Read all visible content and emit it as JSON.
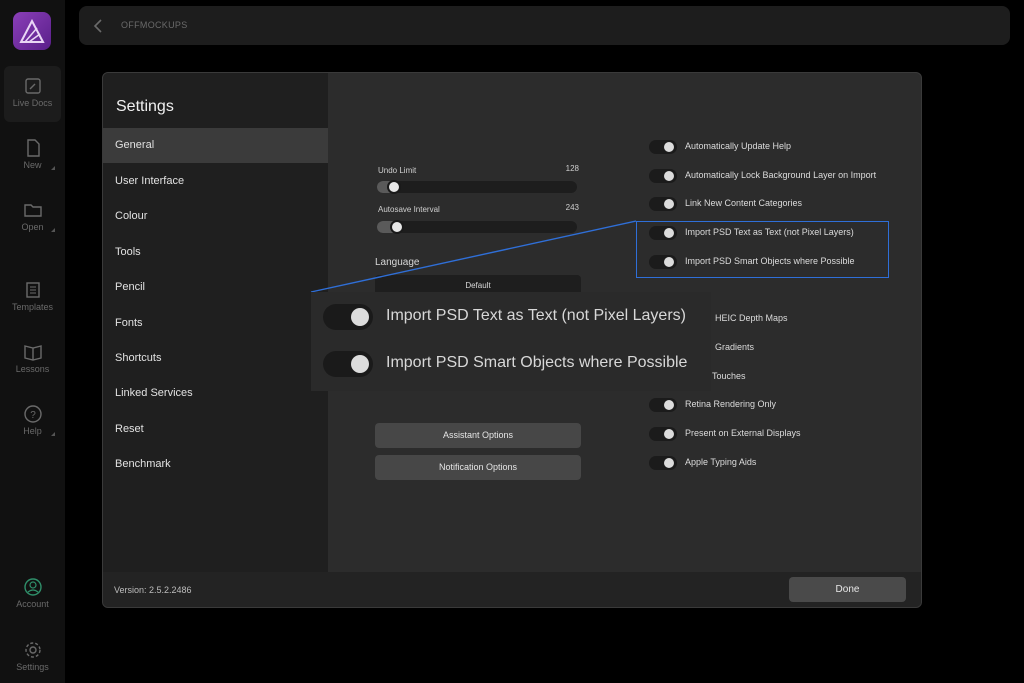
{
  "app": {
    "sidebar": [
      {
        "label": "Live Docs",
        "icon": "live-docs-icon"
      },
      {
        "label": "New",
        "icon": "new-document-icon"
      },
      {
        "label": "Open",
        "icon": "folder-icon"
      },
      {
        "label": "Templates",
        "icon": "templates-icon"
      },
      {
        "label": "Lessons",
        "icon": "book-icon"
      },
      {
        "label": "Help",
        "icon": "help-icon"
      },
      {
        "label": "Account",
        "icon": "account-icon"
      },
      {
        "label": "Settings",
        "icon": "gear-icon"
      }
    ]
  },
  "topbar": {
    "title": "OFFMOCKUPS"
  },
  "dialog": {
    "title": "Settings",
    "nav": [
      "General",
      "User Interface",
      "Colour",
      "Tools",
      "Pencil",
      "Fonts",
      "Shortcuts",
      "Linked Services",
      "Reset",
      "Benchmark"
    ],
    "active_nav": "General",
    "version": "Version: 2.5.2.2486",
    "done_label": "Done",
    "undo_limit": {
      "label": "Undo Limit",
      "value": "128"
    },
    "autosave": {
      "label": "Autosave Interval",
      "value": "243"
    },
    "language": {
      "label": "Language",
      "value": "Default"
    },
    "assistant_label": "Assistant Options",
    "notification_label": "Notification Options",
    "toggles": [
      "Automatically Update Help",
      "Automatically Lock Background Layer on Import",
      "Link New Content Categories",
      "Import PSD Text as Text (not Pixel Layers)",
      "Import PSD Smart Objects where Possible",
      "HEIC Depth Maps",
      "Gradients",
      "Touches",
      "Retina Rendering Only",
      "Present on External Displays",
      "Apple Typing Aids"
    ]
  },
  "zoom": {
    "items": [
      "Import PSD Text as Text (not Pixel Layers)",
      "Import PSD Smart Objects where Possible"
    ]
  },
  "colors": {
    "highlight": "#2f6fd8",
    "accent": "#8a3fb8"
  }
}
